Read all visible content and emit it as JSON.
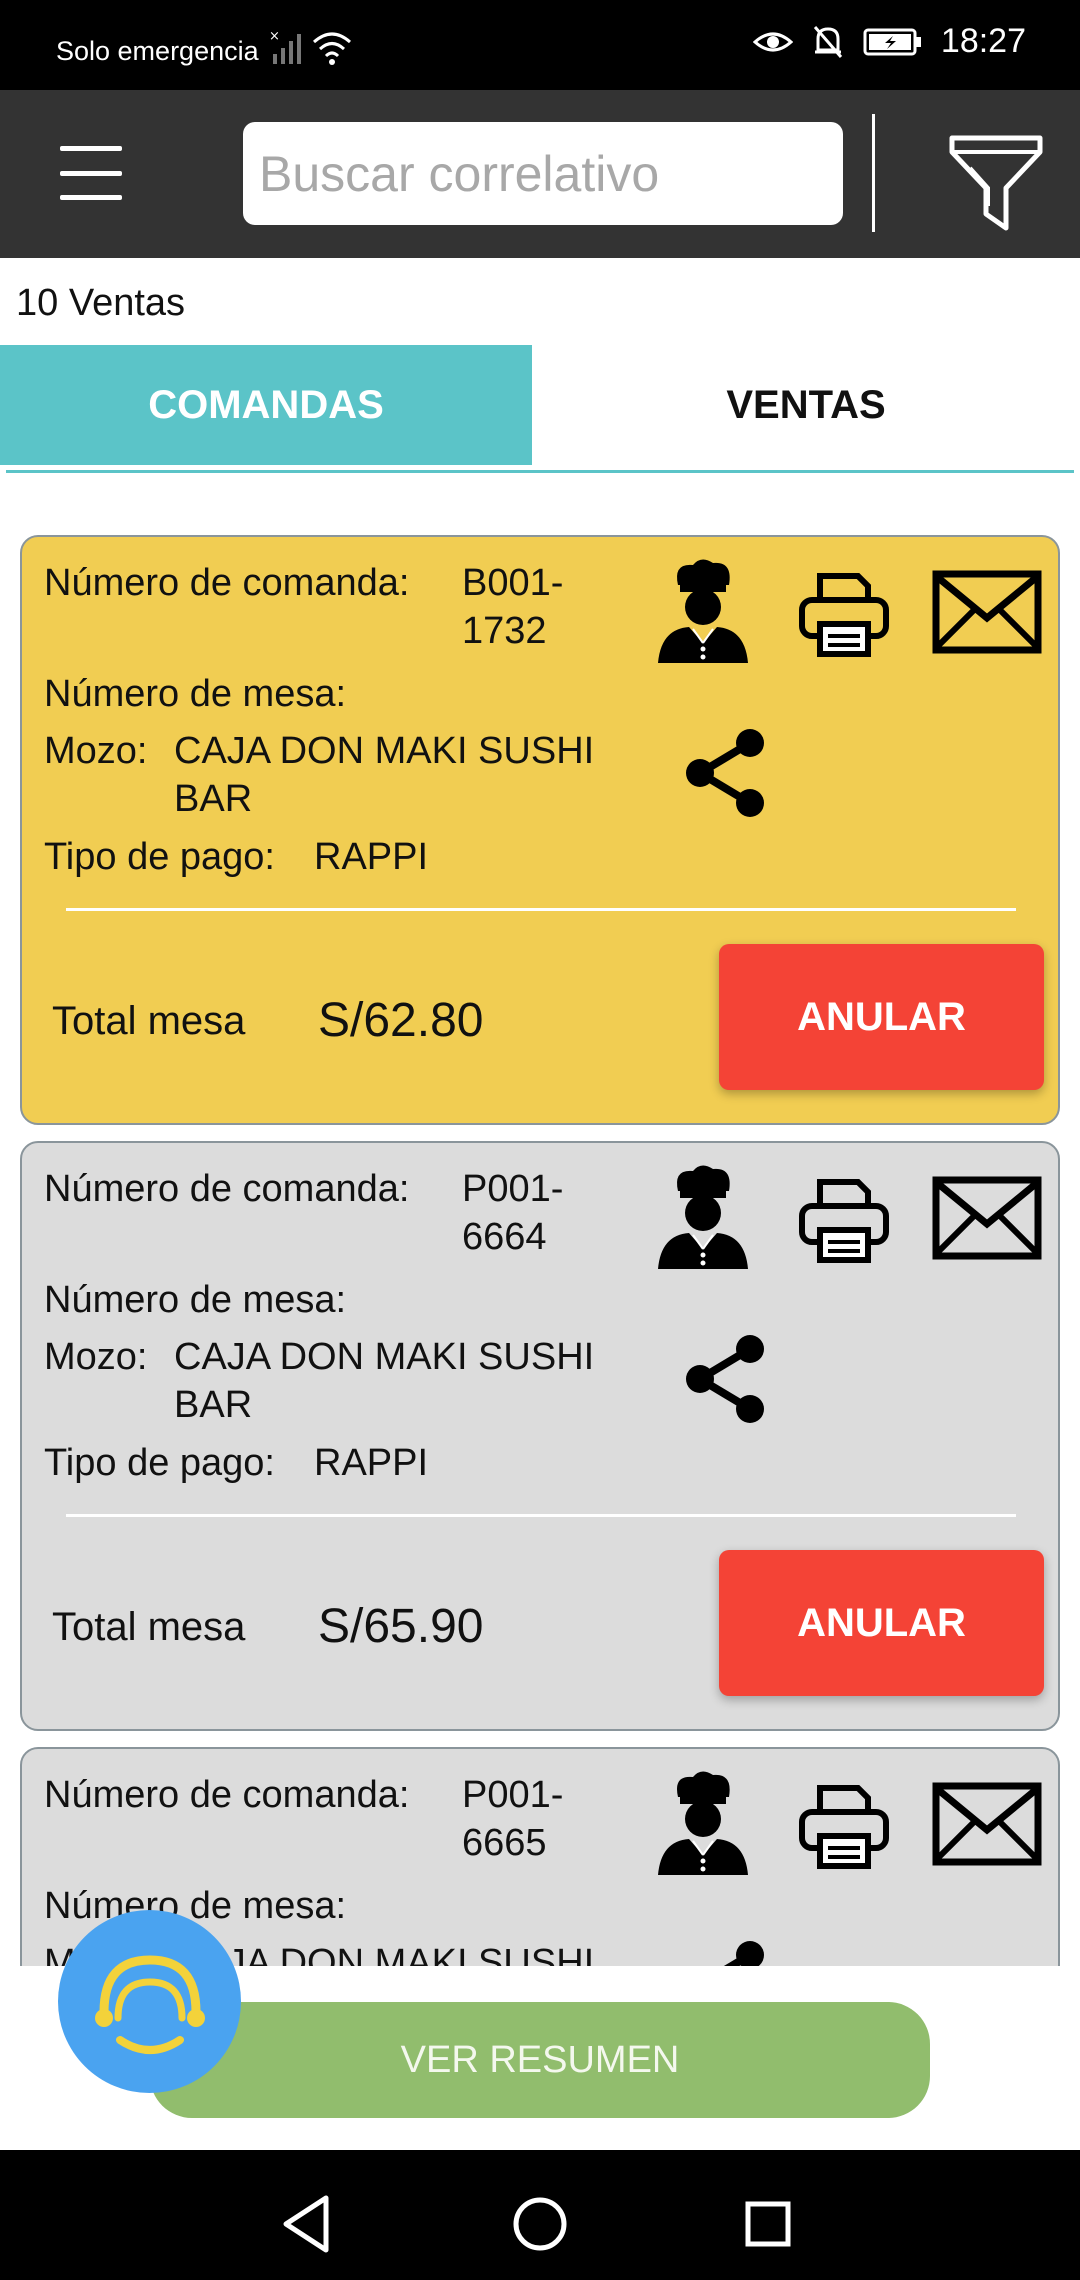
{
  "status_bar": {
    "carrier_text": "Solo emergencia",
    "time": "18:27",
    "icons": [
      "signal-off-icon",
      "wifi-icon",
      "eye-icon",
      "bell-off-icon",
      "battery-charging-icon"
    ]
  },
  "app_bar": {
    "search_placeholder": "Buscar correlativo",
    "icons": [
      "menu-icon",
      "filter-icon"
    ]
  },
  "sales_count": "10 Ventas",
  "tabs": [
    {
      "label": "COMANDAS",
      "active": true
    },
    {
      "label": "VENTAS",
      "active": false
    }
  ],
  "labels": {
    "order_number": "Número de comanda:",
    "table_number": "Número de mesa:",
    "waiter": "Mozo:",
    "payment_type": "Tipo de pago:",
    "table_total": "Total mesa",
    "void_button": "ANULAR"
  },
  "orders": [
    {
      "order_number": "B001-1732",
      "table_number": "",
      "waiter": "CAJA DON MAKI SUSHI BAR",
      "payment_type": "RAPPI",
      "total": "S/62.80",
      "background": "#f1cd52"
    },
    {
      "order_number": "P001-6664",
      "table_number": "",
      "waiter": "CAJA DON MAKI SUSHI BAR",
      "payment_type": "RAPPI",
      "total": "S/65.90",
      "background": "#dcdcdc"
    },
    {
      "order_number": "P001-6665",
      "table_number": "",
      "waiter": "CAJA DON MAKI SUSHI",
      "background": "#dcdcdc"
    }
  ],
  "summary_button": "VER RESUMEN",
  "colors": {
    "accent_teal": "#5bc4c8",
    "void_red": "#f44336",
    "summary_green": "#91bd6d",
    "fab_blue": "#4aa3f0",
    "fab_yellow": "#f3d23a",
    "appbar": "#333333"
  }
}
